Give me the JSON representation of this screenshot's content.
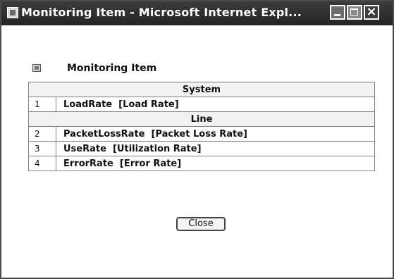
{
  "window": {
    "title": "Monitoring Item - Microsoft Internet Expl...",
    "icons": [
      "ie-window-icon",
      "minimize-icon",
      "maximize-icon",
      "close-icon"
    ]
  },
  "panel": {
    "title": "Monitoring Item",
    "icon": "list-icon"
  },
  "groups": [
    {
      "name": "System",
      "items": [
        {
          "num": "1",
          "label": "LoadRate  [Load Rate]"
        }
      ]
    },
    {
      "name": "Line",
      "items": [
        {
          "num": "2",
          "label": "PacketLossRate  [Packet Loss Rate]"
        },
        {
          "num": "3",
          "label": "UseRate  [Utilization Rate]"
        },
        {
          "num": "4",
          "label": "ErrorRate  [Error Rate]"
        }
      ]
    }
  ],
  "buttons": {
    "close_label": "Close"
  }
}
